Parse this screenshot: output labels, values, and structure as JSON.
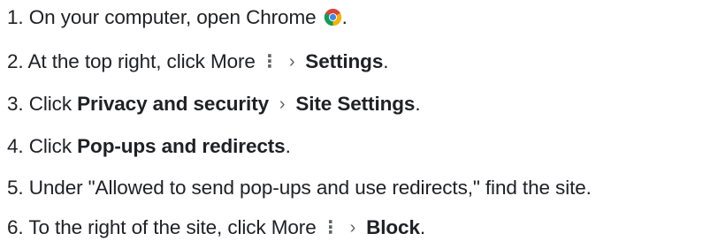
{
  "steps": [
    {
      "number": "1.",
      "text_a": "On your computer, open Chrome",
      "text_b": "."
    },
    {
      "number": "2.",
      "text_a": "At the top right, click More",
      "more_glyph": "⋮",
      "chevron": "›",
      "bold_a": "Settings",
      "text_b": "."
    },
    {
      "number": "3.",
      "text_a": "Click",
      "bold_a": "Privacy and security",
      "chevron": "›",
      "bold_b": "Site Settings",
      "text_b": "."
    },
    {
      "number": "4.",
      "text_a": "Click",
      "bold_a": "Pop-ups and redirects",
      "text_b": "."
    },
    {
      "number": "5.",
      "text_a": "Under \"Allowed to send pop-ups and use redirects,\" find the site."
    },
    {
      "number": "6.",
      "text_a": "To the right of the site, click More",
      "more_glyph": "⋮",
      "chevron": "›",
      "bold_a": "Block",
      "text_b": "."
    }
  ],
  "icons": {
    "chrome": "chrome-icon",
    "more": "more-vert-icon",
    "chevron": "chevron-right-icon"
  },
  "colors": {
    "text": "#202124",
    "icon_gray": "#5f6368",
    "chrome_red": "#db4437",
    "chrome_yellow": "#f4b400",
    "chrome_green": "#0f9d58",
    "chrome_blue": "#4285f4"
  }
}
